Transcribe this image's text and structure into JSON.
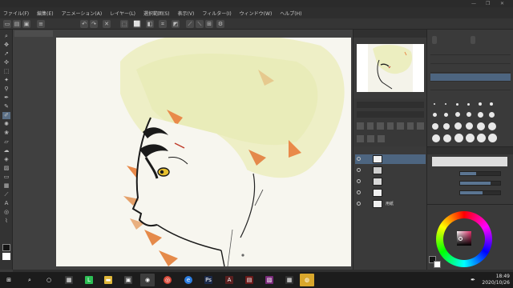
{
  "window": {
    "title": "",
    "minimize": "—",
    "restore": "❐",
    "close": "✕"
  },
  "menu": [
    "ファイル(F)",
    "編集(E)",
    "アニメーション(A)",
    "レイヤー(L)",
    "選択範囲(S)",
    "表示(V)",
    "フィルター(I)",
    "ウィンドウ(W)",
    "ヘルプ(H)"
  ],
  "canvas": {
    "tab_label": "",
    "status_left": ""
  },
  "navigator": {
    "header": ""
  },
  "brush_panel": {
    "tabs": [
      "",
      ""
    ],
    "rows": [
      "",
      "",
      "",
      "",
      ""
    ]
  },
  "layers": [
    {
      "name": "",
      "thumb": "white"
    },
    {
      "name": "",
      "thumb": "grey"
    },
    {
      "name": "",
      "thumb": "grey"
    },
    {
      "name": "",
      "thumb": "white"
    },
    {
      "name": "用紙",
      "thumb": "white"
    }
  ],
  "tool_property": {
    "header": "",
    "labels": [
      "",
      "",
      ""
    ]
  },
  "color": {
    "main": "#141414",
    "sub": "#ffffff"
  },
  "taskbar": {
    "time": "18:49",
    "date": "2020/10/26",
    "icons": [
      "windows-icon",
      "search-icon",
      "task-view-icon",
      "line-icon",
      "explorer-icon",
      "chrome-icon",
      "clip-studio-icon",
      "browser-icon",
      "edge-icon",
      "photoshop-icon",
      "app-icon",
      "app-icon",
      "app-icon",
      "app-icon",
      "clip-studio-paint-icon"
    ]
  }
}
